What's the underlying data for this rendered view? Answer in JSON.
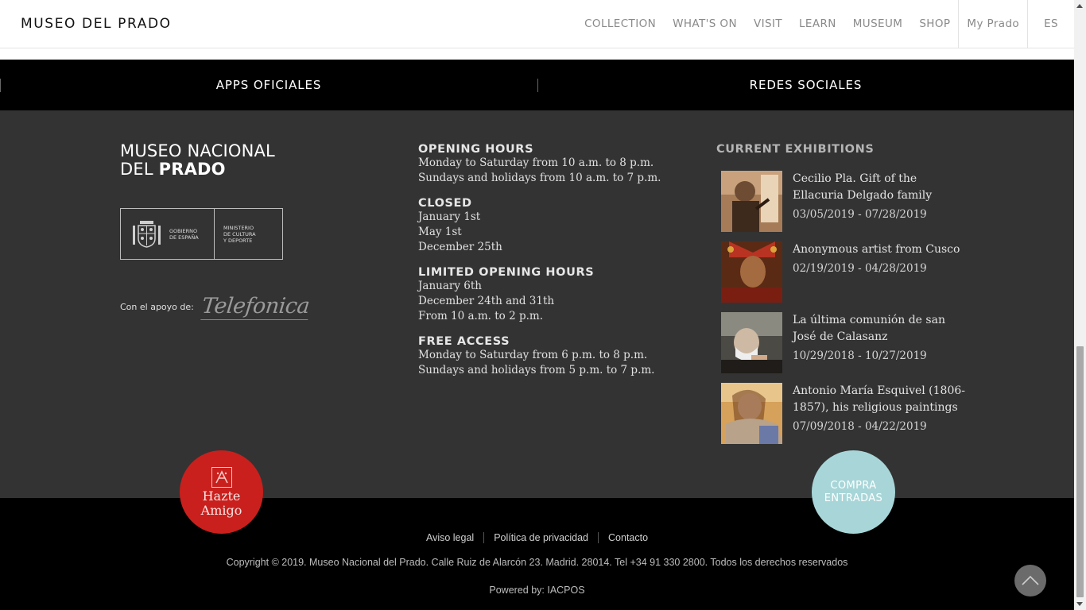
{
  "header": {
    "logo": "MUSEO DEL PRADO",
    "nav": [
      "COLLECTION",
      "WHAT'S ON",
      "VISIT",
      "LEARN",
      "MUSEUM",
      "SHOP"
    ],
    "my_prado": "My Prado",
    "language": "ES"
  },
  "band": {
    "left": "APPS OFICIALES",
    "right": "REDES SOCIALES"
  },
  "brand": {
    "line1": "MUSEO NACIONAL",
    "line2_regular": "DEL ",
    "line2_bold": "PRADO"
  },
  "gov": {
    "left_line1": "GOBIERNO",
    "left_line2": "DE ESPAÑA",
    "right_line1": "MINISTERIO",
    "right_line2": "DE CULTURA",
    "right_line3": "Y DEPORTE"
  },
  "support": {
    "label": "Con el apoyo de:",
    "sponsor": "Telefonica"
  },
  "hours": [
    {
      "heading": "OPENING HOURS",
      "lines": [
        "Monday to Saturday from 10 a.m. to 8 p.m.",
        "Sundays and holidays from 10 a.m. to 7 p.m."
      ]
    },
    {
      "heading": "CLOSED",
      "lines": [
        "January 1st",
        "May 1st",
        "December 25th"
      ]
    },
    {
      "heading": "LIMITED OPENING HOURS",
      "lines": [
        "January 6th",
        "December 24th and 31th",
        "From 10 a.m. to 2 p.m."
      ]
    },
    {
      "heading": "FREE ACCESS",
      "lines": [
        "Monday to Saturday from 6 p.m. to 8 p.m.",
        "Sundays and holidays from 5 p.m. to 7 p.m."
      ]
    }
  ],
  "exhibitions": {
    "title": "CURRENT EXHIBITIONS",
    "items": [
      {
        "name": "Cecilio Pla. Gift of the Ellacuria Delgado family",
        "dates": "03/05/2019 - 07/28/2019"
      },
      {
        "name": "Anonymous artist from Cusco",
        "dates": "02/19/2019 - 04/28/2019"
      },
      {
        "name": "La última comunión de san José de Calasanz",
        "dates": "10/29/2018 - 10/27/2019"
      },
      {
        "name": "Antonio María Esquivel (1806-1857), his religious paintings",
        "dates": "07/09/2018 - 04/22/2019"
      }
    ]
  },
  "amigo": {
    "line1": "Hazte",
    "line2": "Amigo"
  },
  "compra": {
    "line1": "COMPRA",
    "line2": "ENTRADAS"
  },
  "footer": {
    "links": [
      "Aviso legal",
      "Política de privacidad",
      "Contacto"
    ],
    "copyright": "Copyright © 2019. Museo Nacional del Prado. Calle Ruiz de Alarcón 23. Madrid. 28014. Tel +34 91 330 2800. Todos los derechos reservados",
    "powered": "Powered by: IACPOS"
  },
  "colors": {
    "band": "#000000",
    "footer": "#333333",
    "amigo": "#c9201d",
    "compra": "#a8d6d8"
  }
}
